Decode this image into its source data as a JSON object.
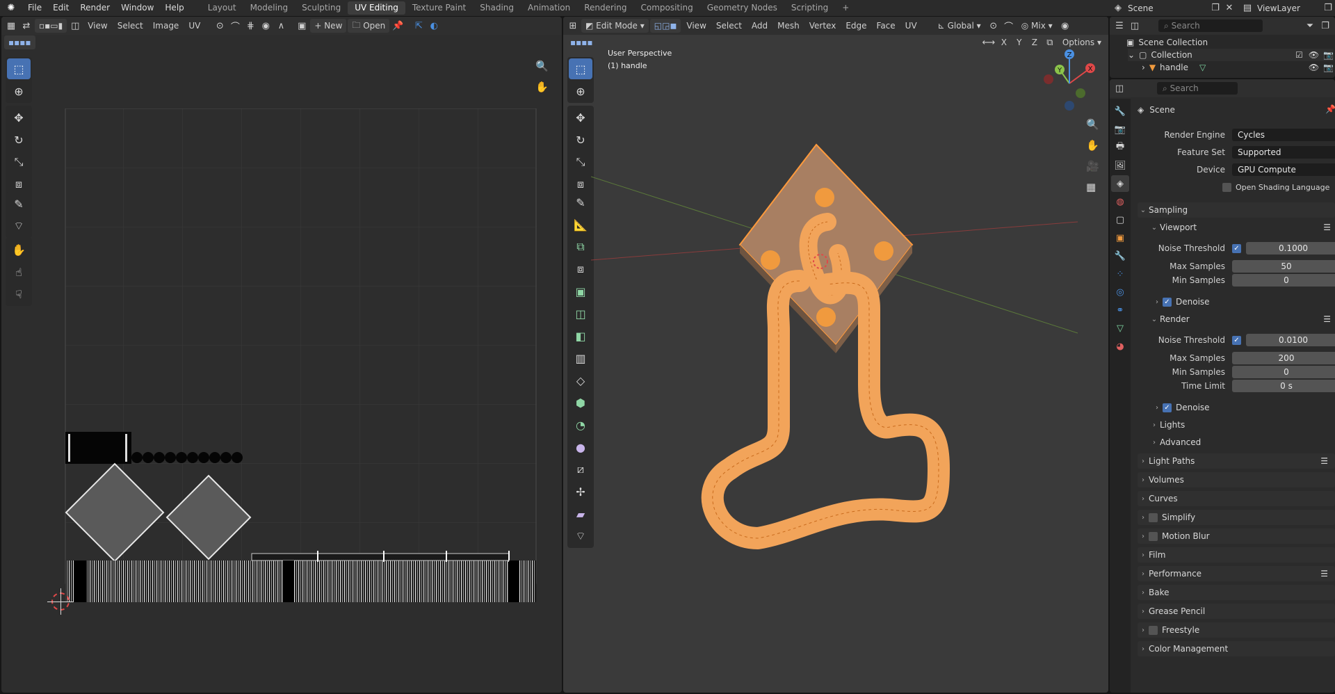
{
  "topbar": {
    "menus": [
      "File",
      "Edit",
      "Render",
      "Window",
      "Help"
    ],
    "workspaces": [
      "Layout",
      "Modeling",
      "Sculpting",
      "UV Editing",
      "Texture Paint",
      "Shading",
      "Animation",
      "Rendering",
      "Compositing",
      "Geometry Nodes",
      "Scripting"
    ],
    "active_workspace": "UV Editing",
    "add_tab": "+",
    "scene_name": "Scene",
    "viewlayer_name": "ViewLayer"
  },
  "uv_editor": {
    "menus": [
      "View",
      "Select",
      "Image",
      "UV"
    ],
    "new_label": "New",
    "open_label": "Open"
  },
  "viewport": {
    "mode": "Edit Mode",
    "menus": [
      "View",
      "Select",
      "Add",
      "Mesh",
      "Vertex",
      "Edge",
      "Face",
      "UV"
    ],
    "orientation": "Global",
    "shading_mix": "Mix",
    "options_label": "Options",
    "axes": [
      "X",
      "Y",
      "Z"
    ],
    "overlay_line1": "User Perspective",
    "overlay_line2": "(1) handle",
    "gizmo": {
      "x": "X",
      "y": "Y",
      "z": "Z"
    },
    "colors": {
      "mesh": "#e8892b",
      "background": "#3a3a3a"
    }
  },
  "outliner": {
    "search_placeholder": "Search",
    "scene_collection": "Scene Collection",
    "collection": "Collection",
    "object": "handle"
  },
  "properties": {
    "search_placeholder": "Search",
    "context": "Scene",
    "render_engine_label": "Render Engine",
    "render_engine": "Cycles",
    "feature_set_label": "Feature Set",
    "feature_set": "Supported",
    "device_label": "Device",
    "device": "GPU Compute",
    "osl_label": "Open Shading Language",
    "sampling": "Sampling",
    "viewport": "Viewport",
    "noise_threshold_label": "Noise Threshold",
    "vp_noise_threshold": "0.1000",
    "max_samples_label": "Max Samples",
    "vp_max_samples": "50",
    "min_samples_label": "Min Samples",
    "vp_min_samples": "0",
    "denoise_label": "Denoise",
    "render": "Render",
    "r_noise_threshold": "0.0100",
    "r_max_samples": "200",
    "r_min_samples": "0",
    "time_limit_label": "Time Limit",
    "r_time_limit": "0 s",
    "lights": "Lights",
    "advanced": "Advanced",
    "panels": [
      "Light Paths",
      "Volumes",
      "Curves",
      "Simplify",
      "Motion Blur",
      "Film",
      "Performance",
      "Bake",
      "Grease Pencil",
      "Freestyle",
      "Color Management"
    ]
  }
}
